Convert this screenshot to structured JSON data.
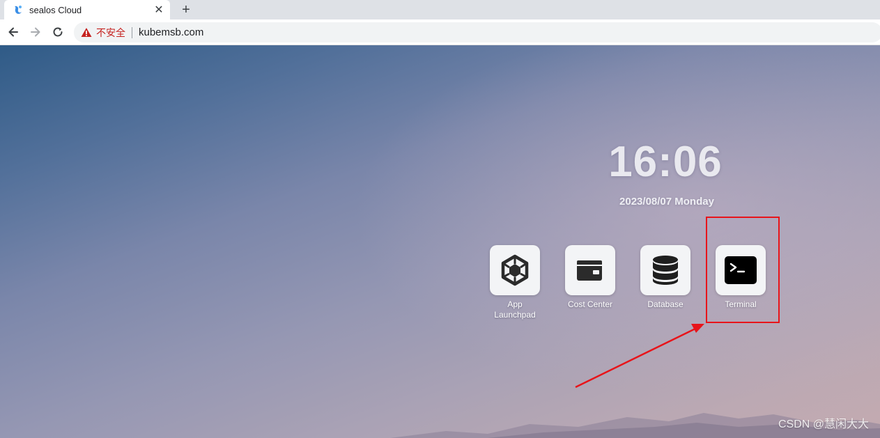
{
  "browser": {
    "tab_title": "sealos Cloud",
    "tab_close": "✕",
    "new_tab": "+",
    "security_label": "不安全",
    "url": "kubemsb.com"
  },
  "desktop": {
    "time": "16:06",
    "date": "2023/08/07 Monday",
    "apps": [
      {
        "label": "App Launchpad",
        "icon": "hexagon-cube-icon"
      },
      {
        "label": "Cost Center",
        "icon": "wallet-icon"
      },
      {
        "label": "Database",
        "icon": "database-icon"
      },
      {
        "label": "Terminal",
        "icon": "terminal-icon"
      }
    ],
    "highlighted_app": "Terminal",
    "annotation_color": "#e8141a"
  },
  "watermark": "CSDN @慧闲大大"
}
